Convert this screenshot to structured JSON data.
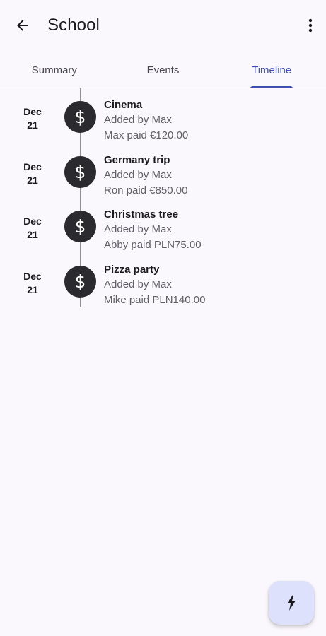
{
  "app_bar": {
    "title": "School",
    "back_icon": "arrow-back-icon",
    "more_icon": "more-vert-icon"
  },
  "tabs": [
    {
      "label": "Summary",
      "active": false
    },
    {
      "label": "Events",
      "active": false
    },
    {
      "label": "Timeline",
      "active": true
    }
  ],
  "timeline": {
    "entries": [
      {
        "month": "Dec",
        "day": "21",
        "icon": "dollar-icon",
        "symbol": "$",
        "title": "Cinema",
        "added_by": "Added by Max",
        "paid": "Max paid €120.00"
      },
      {
        "month": "Dec",
        "day": "21",
        "icon": "dollar-icon",
        "symbol": "$",
        "title": "Germany trip",
        "added_by": "Added by Max",
        "paid": "Ron paid €850.00"
      },
      {
        "month": "Dec",
        "day": "21",
        "icon": "dollar-icon",
        "symbol": "$",
        "title": "Christmas tree",
        "added_by": "Added by Max",
        "paid": "Abby paid PLN75.00"
      },
      {
        "month": "Dec",
        "day": "21",
        "icon": "dollar-icon",
        "symbol": "$",
        "title": "Pizza party",
        "added_by": "Added by Max",
        "paid": "Mike paid PLN140.00"
      }
    ]
  },
  "fab": {
    "icon": "flash-icon"
  },
  "colors": {
    "accent": "#3d4fb4",
    "background": "#fbf8fd",
    "marker": "#2b2b2f",
    "fab_background": "#dde1fb"
  }
}
